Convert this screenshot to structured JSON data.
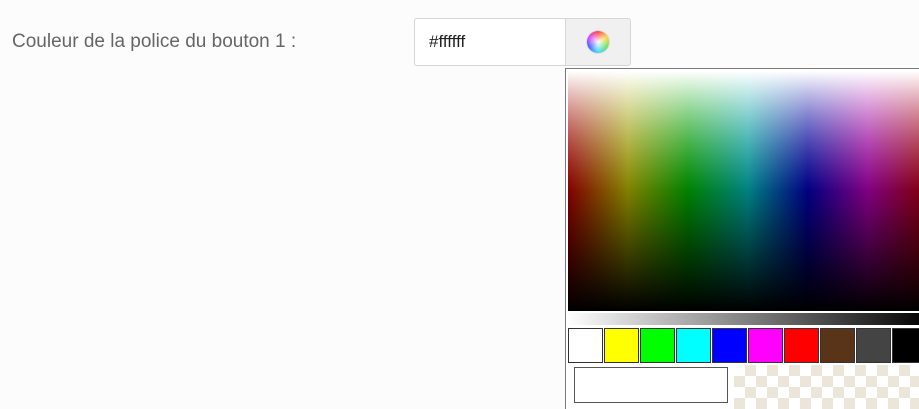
{
  "field": {
    "label": "Couleur de la police du bouton 1 :",
    "value": "#ffffff"
  },
  "picker_button": {
    "icon": "color-wheel-icon"
  },
  "picker": {
    "swatches": [
      "#ffffff",
      "#ffff00",
      "#00ff00",
      "#00ffff",
      "#0000ff",
      "#ff00ff",
      "#ff0000",
      "#5a3418",
      "#444444",
      "#000000"
    ],
    "preview_color": "#ffffff"
  }
}
